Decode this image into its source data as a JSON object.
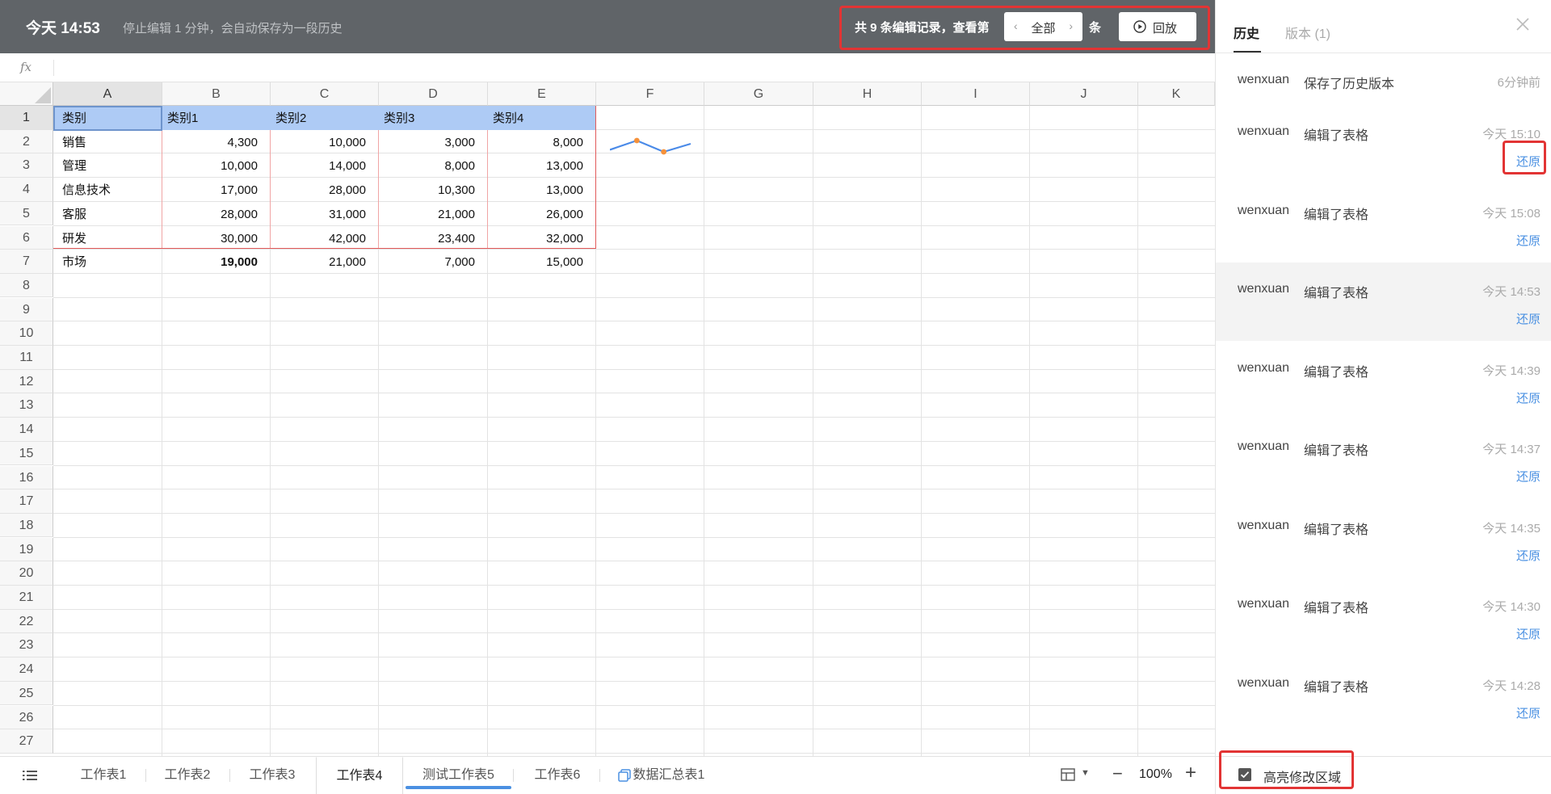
{
  "header": {
    "time": "今天 14:53",
    "status": "停止编辑 1 分钟，会自动保存为一段历史",
    "records_prefix": "共 9 条编辑记录，查看第",
    "pager_label": "全部",
    "records_suffix": "条",
    "replay_label": "回放"
  },
  "formula": {
    "fx": "fx",
    "value": ""
  },
  "columns": [
    "A",
    "B",
    "C",
    "D",
    "E",
    "F",
    "G",
    "H",
    "I",
    "J",
    "K"
  ],
  "rows": [
    "1",
    "2",
    "3",
    "4",
    "5",
    "6",
    "7",
    "8",
    "9",
    "10",
    "11",
    "12",
    "13",
    "14",
    "15",
    "16",
    "17",
    "18",
    "19",
    "20",
    "21",
    "22",
    "23",
    "24",
    "25",
    "26",
    "27"
  ],
  "table": {
    "header": [
      "类别",
      "类别1",
      "类别2",
      "类别3",
      "类别4"
    ],
    "rows": [
      [
        "销售",
        "4,300",
        "10,000",
        "3,000",
        "8,000"
      ],
      [
        "管理",
        "10,000",
        "14,000",
        "8,000",
        "13,000"
      ],
      [
        "信息技术",
        "17,000",
        "28,000",
        "10,300",
        "13,000"
      ],
      [
        "客服",
        "28,000",
        "31,000",
        "21,000",
        "26,000"
      ],
      [
        "研发",
        "30,000",
        "42,000",
        "23,400",
        "32,000"
      ],
      [
        "市场",
        "19,000",
        "21,000",
        "7,000",
        "15,000"
      ]
    ]
  },
  "sparkline": {
    "values": [
      4300,
      10000,
      3000,
      8000
    ],
    "line_color": "#4a8ae8",
    "marker_color": "#f5913a"
  },
  "sheet_tabs": {
    "tabs": [
      "工作表1",
      "工作表2",
      "工作表3",
      "工作表4",
      "测试工作表5",
      "工作表6",
      "数据汇总表1"
    ],
    "active": "工作表4",
    "zoom": "100%"
  },
  "panel": {
    "tab_history": "历史",
    "tab_version": "版本 (1)",
    "entries": [
      {
        "user": "wenxuan",
        "action": "保存了历史版本",
        "time": "6分钟前"
      },
      {
        "user": "wenxuan",
        "action": "编辑了表格",
        "time": "今天 15:10",
        "restore": "还原"
      },
      {
        "user": "wenxuan",
        "action": "编辑了表格",
        "time": "今天 15:08",
        "restore": "还原"
      },
      {
        "user": "wenxuan",
        "action": "编辑了表格",
        "time": "今天 14:53",
        "restore": "还原"
      },
      {
        "user": "wenxuan",
        "action": "编辑了表格",
        "time": "今天 14:39",
        "restore": "还原"
      },
      {
        "user": "wenxuan",
        "action": "编辑了表格",
        "time": "今天 14:37",
        "restore": "还原"
      },
      {
        "user": "wenxuan",
        "action": "编辑了表格",
        "time": "今天 14:35",
        "restore": "还原"
      },
      {
        "user": "wenxuan",
        "action": "编辑了表格",
        "time": "今天 14:30",
        "restore": "还原"
      },
      {
        "user": "wenxuan",
        "action": "编辑了表格",
        "time": "今天 14:28",
        "restore": "还原"
      }
    ],
    "highlight_label": "高亮修改区域",
    "highlight_checked": true
  },
  "colors": {
    "topbar": "#606468",
    "accent": "#4a90e2",
    "annotation": "#e23434",
    "header_fill": "#aecbf5"
  }
}
